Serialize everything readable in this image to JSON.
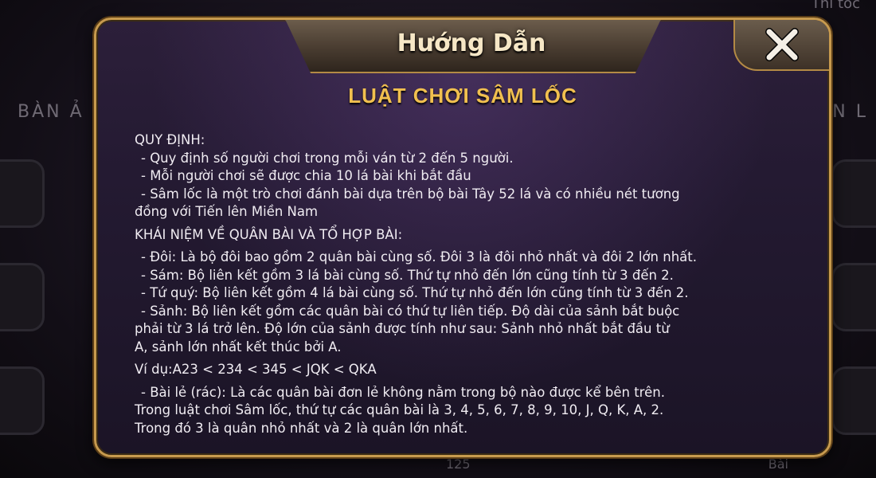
{
  "background": {
    "left_label": "BÀN Ả",
    "right_label": "N L",
    "top_right": "Thi tốc",
    "bottom_left": "125",
    "bottom_right": "Bài"
  },
  "dialog": {
    "header_title": "Hướng Dẫn",
    "close_icon": "close-icon",
    "rules_title": "LUẬT CHƠI SÂM LỐC",
    "colors": {
      "gold": "#f1c04f",
      "frame": "#c79a4e",
      "text": "#f0ecf2"
    }
  },
  "content": {
    "section1_title": "QUY ĐỊNH:",
    "section1_items": [
      "- Quy định số người chơi trong mỗi ván từ 2 đến 5 người.",
      "- Mỗi người chơi sẽ được chia 10 lá bài khi bắt đầu",
      "- Sâm lốc là một trò chơi đánh bài dựa trên bộ bài Tây 52 lá và có nhiều nét tương",
      "đồng với Tiến lên Miền Nam"
    ],
    "section2_title": "KHÁI NIỆM VỀ QUÂN BÀI VÀ TỔ HỢP BÀI:",
    "section2_items": [
      "- Đôi: Là bộ đôi bao gồm 2 quân bài cùng số. Đôi 3 là đôi nhỏ nhất và đôi 2 lớn nhất.",
      "- Sám: Bộ liên kết gồm 3 lá bài cùng số. Thứ tự nhỏ đến lớn cũng tính từ 3 đến 2.",
      "- Tứ quý: Bộ liên kết gồm 4 lá bài cùng số. Thứ tự nhỏ đến lớn cũng tính từ 3 đến 2.",
      "- Sảnh: Bộ liên kết gồm các quân bài có thứ tự liên tiếp. Độ dài của sảnh bắt buộc",
      "phải từ 3 lá trở lên. Độ lớn của sảnh được tính như sau: Sảnh nhỏ nhất bắt đầu từ",
      "A, sảnh lớn nhất kết thúc bởi A."
    ],
    "example": "Ví dụ:A23 < 234 < 345 < JQK < QKA",
    "section3_items": [
      "- Bài lẻ (rác): Là các quân bài đơn lẻ không nằm trong bộ nào được kể bên trên.",
      "Trong luật chơi Sâm lốc, thứ tự các quân bài là 3, 4, 5, 6, 7, 8, 9, 10, J, Q, K, A, 2.",
      "Trong đó 3 là quân nhỏ nhất và 2 là quân lớn nhất."
    ]
  }
}
